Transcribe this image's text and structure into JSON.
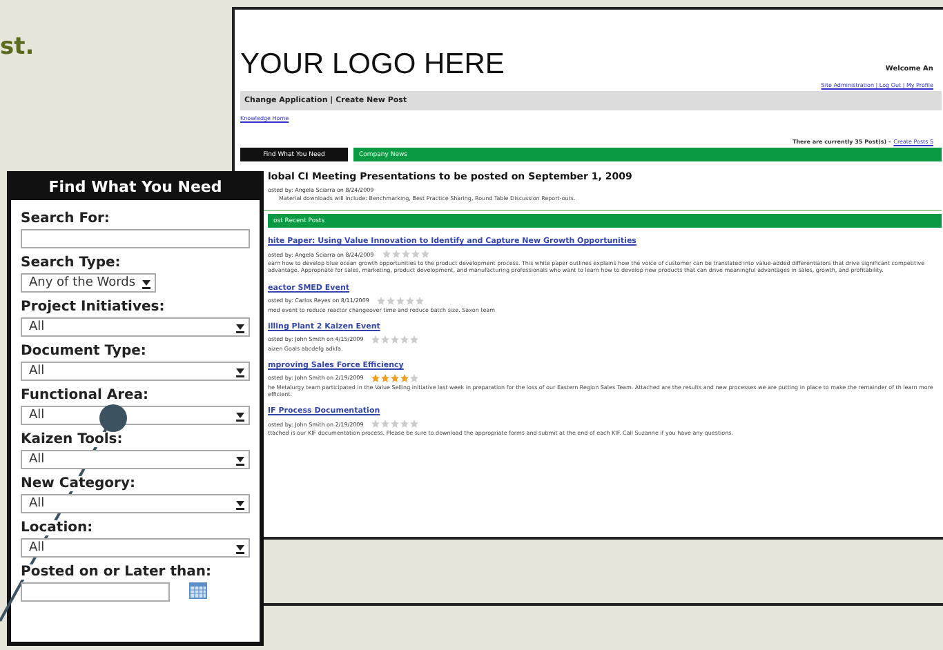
{
  "intro_text": "st.",
  "screenshot": {
    "logo": "YOUR LOGO HERE",
    "welcome": "Welcome An",
    "user_links": "Site Administration | Log Out | My Profile",
    "nav": "Change Application  |  Create New Post",
    "breadcrumb": "Knowledge Home",
    "sidebar_title": "Find What You Need",
    "post_count": "There are currently 35 Post(s) -",
    "create_link": "Create Posts S",
    "news_header": "Company News",
    "news": {
      "title": "lobal CI Meeting Presentations to be posted on September 1, 2009",
      "posted": "osted by: Angela Sciarra on 8/24/2009",
      "body": "Material downloads will include: Benchmarking, Best Practice Sharing, Round Table Discussion Report-outs."
    },
    "recent_header": "ost Recent Posts",
    "posts": [
      {
        "title": "hite Paper: Using Value Innovation to Identify and Capture New Growth Opportunities",
        "posted": "osted by: Angela Sciarra on 8/24/2009",
        "stars": 0,
        "body": "earn how to develop blue ocean growth opportunities to the product development process. This white paper outlines explains how the voice of customer can be translated into value-added differentiators that drive significant competitive advantage. Appropriate for sales, marketing, product development, and manufacturing professionals who want to learn how to develop new products that can drive meaningful advantages in sales, growth, and profitability."
      },
      {
        "title": "eactor SMED Event",
        "posted": "osted by: Carlos Reyes on 8/11/2009",
        "stars": 0,
        "body": "med event to reduce reactor changeover time and reduce batch size. Saxon team"
      },
      {
        "title": "illing Plant 2 Kaizen Event",
        "posted": "osted by: John Smith on 4/15/2009",
        "stars": 0,
        "body": "aizen Goals abcdefg adkfa."
      },
      {
        "title": "mproving Sales Force Efficiency",
        "posted": "osted by: John Smith on 2/19/2009",
        "stars": 4,
        "body": "he Metalurgy team participated in the Value Selling initiative last week in preparation for the loss of our Eastern Region Sales Team. Attached are the results and new processes we are putting in place to make the remainder of th learn more efficient."
      },
      {
        "title": "IF Process Documentation",
        "posted": "osted by: John Smith on 2/19/2009",
        "stars": 0,
        "body": "ttached is our KIF documentation process. Please be sure to download the appropriate forms and submit at the end of each KIF. Call Suzanne if you have any questions."
      }
    ]
  },
  "search_panel": {
    "title": "Find What You Need",
    "fields": [
      {
        "kind": "text",
        "label": "Search For:"
      },
      {
        "kind": "short_select",
        "label": "Search Type:",
        "value": "Any of the Words"
      },
      {
        "kind": "select",
        "label": "Project Initiatives:",
        "value": "All"
      },
      {
        "kind": "select",
        "label": "Document Type:",
        "value": "All"
      },
      {
        "kind": "select",
        "label": "Functional Area:",
        "value": "All"
      },
      {
        "kind": "select",
        "label": "Kaizen Tools:",
        "value": "All"
      },
      {
        "kind": "select",
        "label": "New Category:",
        "value": "All"
      },
      {
        "kind": "select",
        "label": "Location:",
        "value": "All"
      },
      {
        "kind": "date",
        "label": "Posted on or Later than:"
      }
    ]
  }
}
